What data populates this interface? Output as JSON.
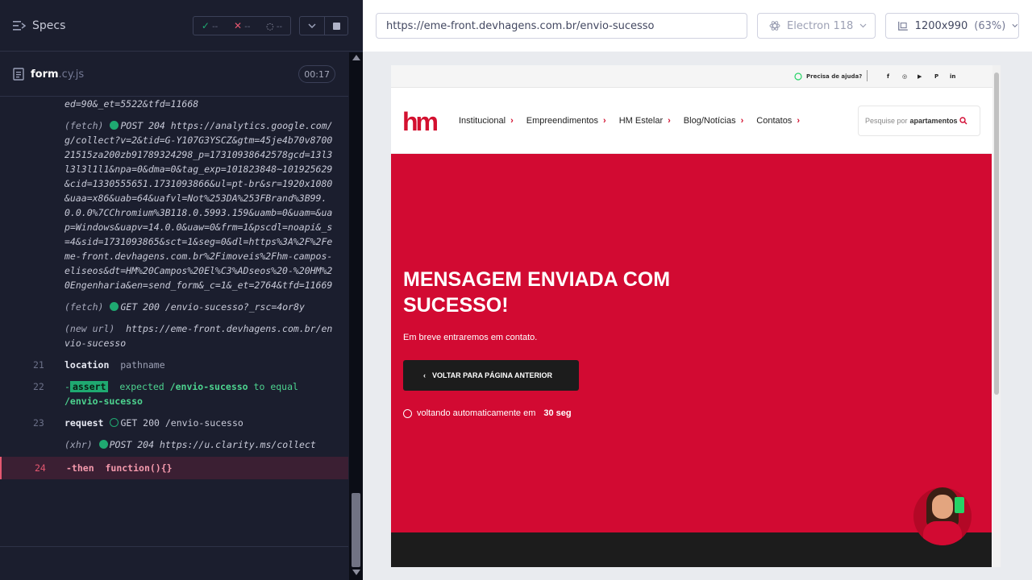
{
  "reporter": {
    "specs_label": "Specs",
    "stats": {
      "passed": "--",
      "failed": "--",
      "pending": "--"
    },
    "spec_file": {
      "name": "form",
      "ext": ".cy.js",
      "timer": "00:17"
    },
    "commands": [
      {
        "num": "",
        "name": "",
        "message": "ed=90&_et=5522&tfd=11668"
      },
      {
        "num": "",
        "name": "(fetch)",
        "dot": "filled",
        "message": "POST 204 https://analytics.google.com/g/collect?v=2&tid=G-Y107G3YSCZ&gtm=45je4b70v870021515za200zb91789324298_p=17310938642578gcd=13l3l3l3l1l1&npa=0&dma=0&tag_exp=101823848~101925629&cid=1330555651.1731093866&ul=pt-br&sr=1920x1080&uaa=x86&uab=64&uafvl=Not%253DA%253FBrand%3B99.0.0.0%7CChromium%3B118.0.5993.159&uamb=0&uam=&uap=Windows&uapv=14.0.0&uaw=0&frm=1&pscdl=noapi&_s=4&sid=1731093865&sct=1&seg=0&dl=https%3A%2F%2Feme-front.devhagens.com.br%2Fimoveis%2Fhm-campos-eliseos&dt=HM%20Campos%20El%C3%ADseos%20-%20HM%20Engenharia&en=send_form&_c=1&_et=2764&tfd=11669"
      },
      {
        "num": "",
        "name": "(fetch)",
        "dot": "filled",
        "message": "GET 200 /envio-sucesso?_rsc=4or8y"
      },
      {
        "num": "",
        "name": "(new url)",
        "message": "https://eme-front.devhagens.com.br/envio-sucesso"
      },
      {
        "num": "21",
        "name": "location",
        "message": "pathname"
      },
      {
        "num": "22",
        "name": "-",
        "assert_label": "assert",
        "expected_text": "expected",
        "expected_value": "/envio-sucesso",
        "to_equal_text": "to equal",
        "actual_value": "/envio-sucesso"
      },
      {
        "num": "23",
        "name": "request",
        "dot": "hollow",
        "message": "GET 200 /envio-sucesso"
      },
      {
        "num": "",
        "name": "(xhr)",
        "dot": "filled",
        "message": "POST 204 https://u.clarity.ms/collect"
      },
      {
        "num": "24",
        "name": "-then",
        "message": "function(){}"
      }
    ]
  },
  "aut": {
    "url": "https://eme-front.devhagens.com.br/envio-sucesso",
    "browser": "Electron 118",
    "viewport": "1200x990",
    "zoom": "(63%)"
  },
  "site": {
    "topbar": {
      "help": "Precisa de ajuda?",
      "social": [
        "f",
        "◎",
        "▶",
        "P",
        "in"
      ]
    },
    "logo": "hm",
    "menu": [
      "Institucional",
      "Empreendimentos",
      "HM Estelar",
      "Blog/Notícias",
      "Contatos"
    ],
    "search_placeholder": "Pesquise por",
    "search_bold": "apartamentos",
    "hero": {
      "title": "MENSAGEM ENVIADA COM SUCESSO!",
      "subtitle": "Em breve entraremos em contato.",
      "back_button": "VOLTAR PARA PÁGINA ANTERIOR",
      "auto_text": "voltando automaticamente em",
      "countdown": "30 seg"
    },
    "colors": {
      "brand": "#d20a32",
      "dark": "#1c1c1c"
    }
  }
}
